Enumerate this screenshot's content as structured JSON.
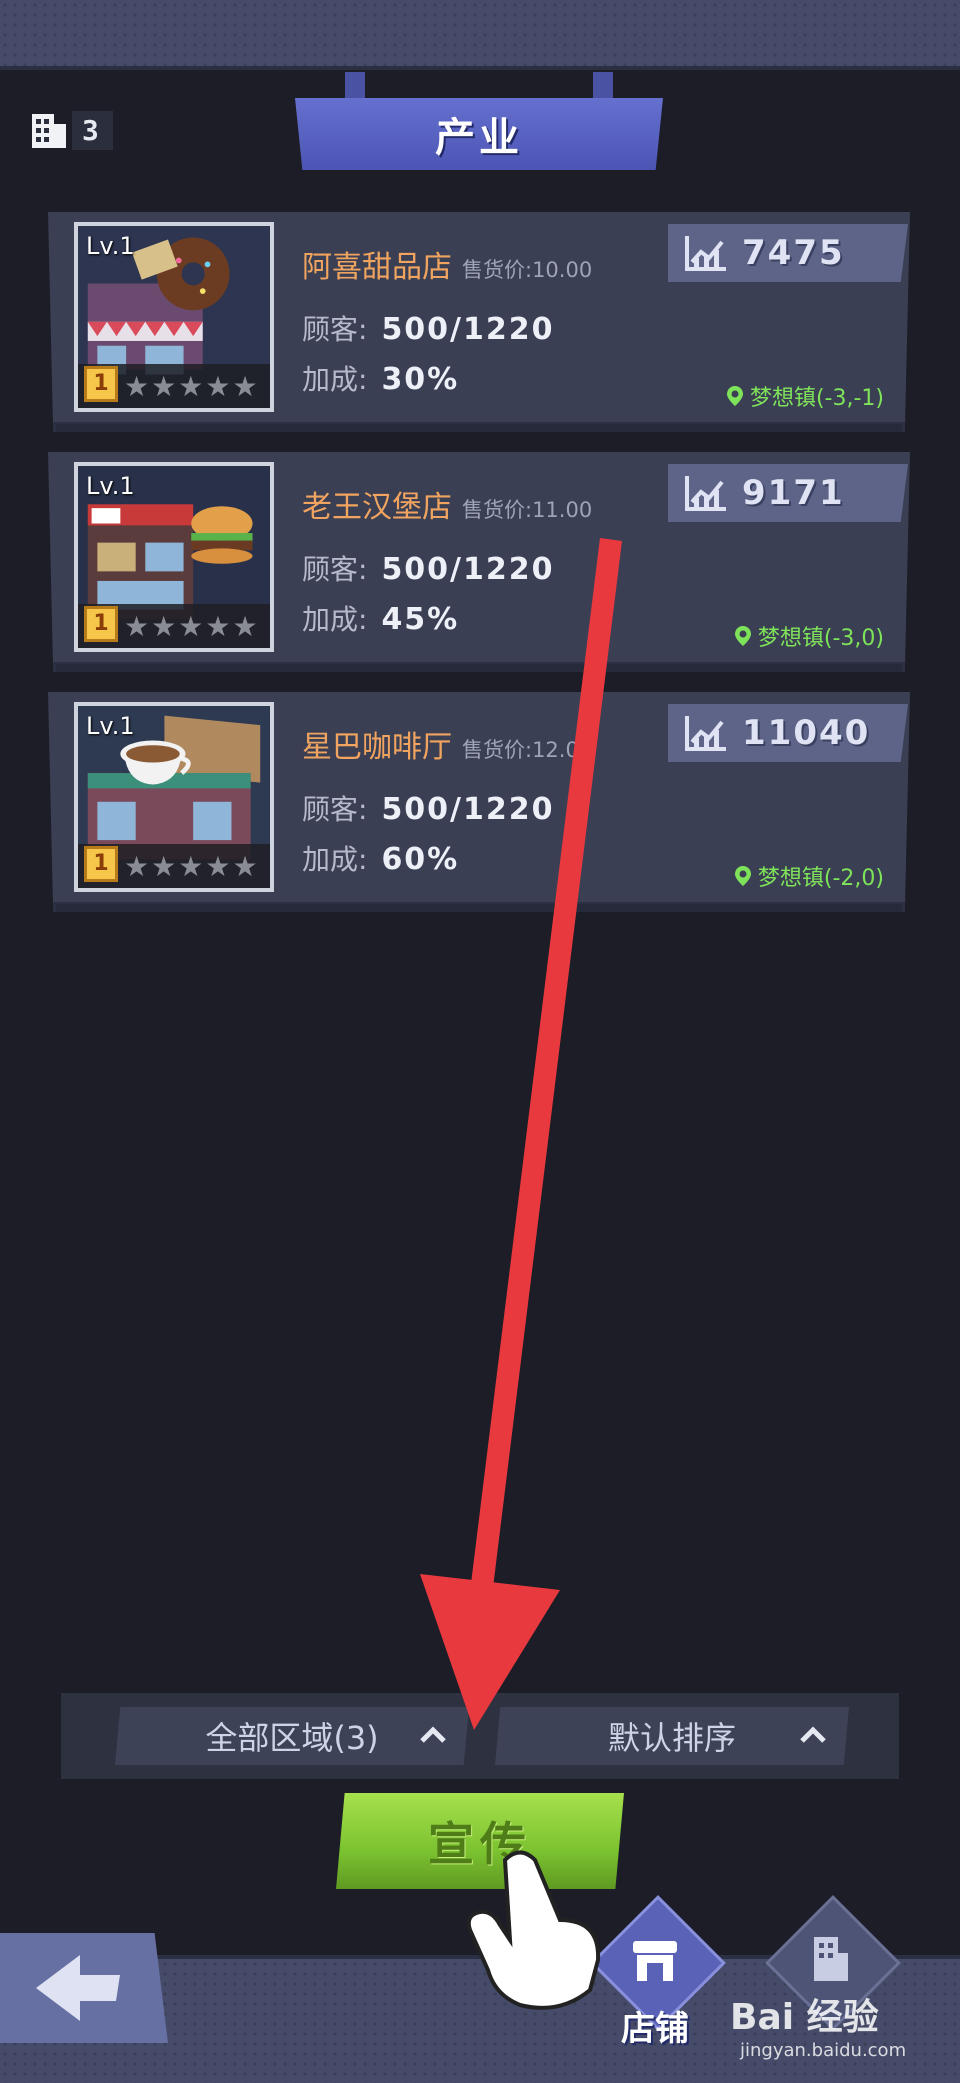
{
  "header": {
    "title": "产业",
    "building_count": "3"
  },
  "shops": [
    {
      "level": "Lv.1",
      "name": "阿喜甜品店",
      "price_label": "售货价:10.00",
      "customers_label": "顾客:",
      "customers": "500/1220",
      "bonus_label": "加成:",
      "bonus": "30%",
      "score": "7475",
      "location": "梦想镇(-3,-1)",
      "rank": "1"
    },
    {
      "level": "Lv.1",
      "name": "老王汉堡店",
      "price_label": "售货价:11.00",
      "customers_label": "顾客:",
      "customers": "500/1220",
      "bonus_label": "加成:",
      "bonus": "45%",
      "score": "9171",
      "location": "梦想镇(-3,0)",
      "rank": "1"
    },
    {
      "level": "Lv.1",
      "name": "星巴咖啡厅",
      "price_label": "售货价:12.00",
      "customers_label": "顾客:",
      "customers": "500/1220",
      "bonus_label": "加成:",
      "bonus": "60%",
      "score": "11040",
      "location": "梦想镇(-2,0)",
      "rank": "1"
    }
  ],
  "filters": {
    "region": "全部区域(3)",
    "sort": "默认排序"
  },
  "promo_button": "宣传",
  "bottom_nav": {
    "shop_tab": "店铺",
    "other_tab": "经验"
  },
  "watermark": {
    "brand": "Bai 经验",
    "url": "jingyan.baidu.com"
  },
  "colors": {
    "background": "#1c1d26",
    "card": "#3b3f54",
    "shop_name": "#f0a45f",
    "location": "#7fe35a",
    "promo_button": "#8fd23c",
    "annotation_arrow": "#e8393f"
  }
}
